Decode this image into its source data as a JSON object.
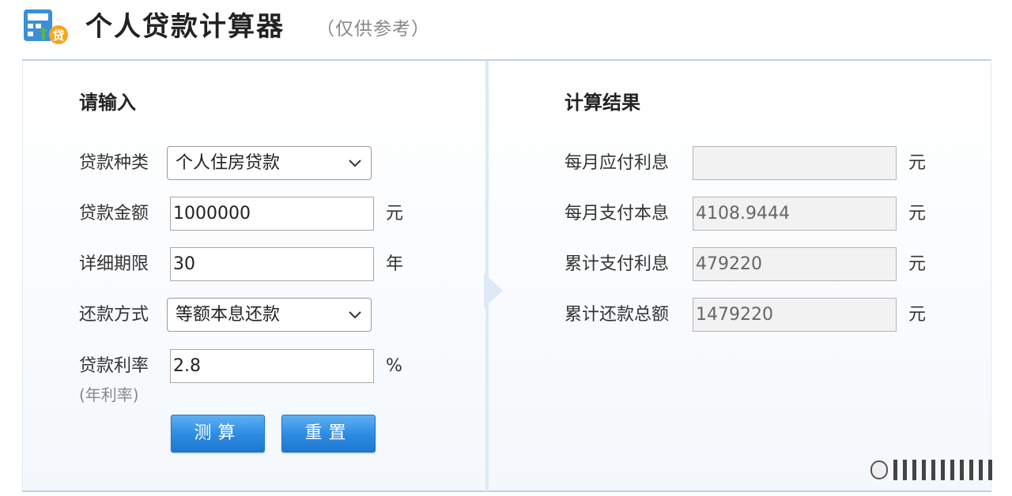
{
  "header": {
    "title": "个人贷款计算器",
    "subtitle": "（仅供参考）",
    "logo_icon": "loan-calculator-icon"
  },
  "input_section": {
    "title": "请输入",
    "loan_type": {
      "label": "贷款种类",
      "value": "个人住房贷款"
    },
    "loan_amount": {
      "label": "贷款金额",
      "value": "1000000",
      "unit": "元"
    },
    "loan_term": {
      "label": "详细期限",
      "value": "30",
      "unit": "年"
    },
    "repayment_method": {
      "label": "还款方式",
      "value": "等额本息还款"
    },
    "interest_rate": {
      "label": "贷款利率",
      "sublabel": "(年利率)",
      "value": "2.8",
      "unit": "%"
    },
    "calculate_button": "测算",
    "reset_button": "重置"
  },
  "result_section": {
    "title": "计算结果",
    "monthly_interest": {
      "label": "每月应付利息",
      "value": "",
      "unit": "元"
    },
    "monthly_payment": {
      "label": "每月支付本息",
      "value": "4108.9444",
      "unit": "元"
    },
    "total_interest": {
      "label": "累计支付利息",
      "value": "479220",
      "unit": "元"
    },
    "total_repayment": {
      "label": "累计还款总额",
      "value": "1479220",
      "unit": "元"
    }
  },
  "colors": {
    "button_blue": "#2b8ae0",
    "divider": "#b9d3e8"
  }
}
